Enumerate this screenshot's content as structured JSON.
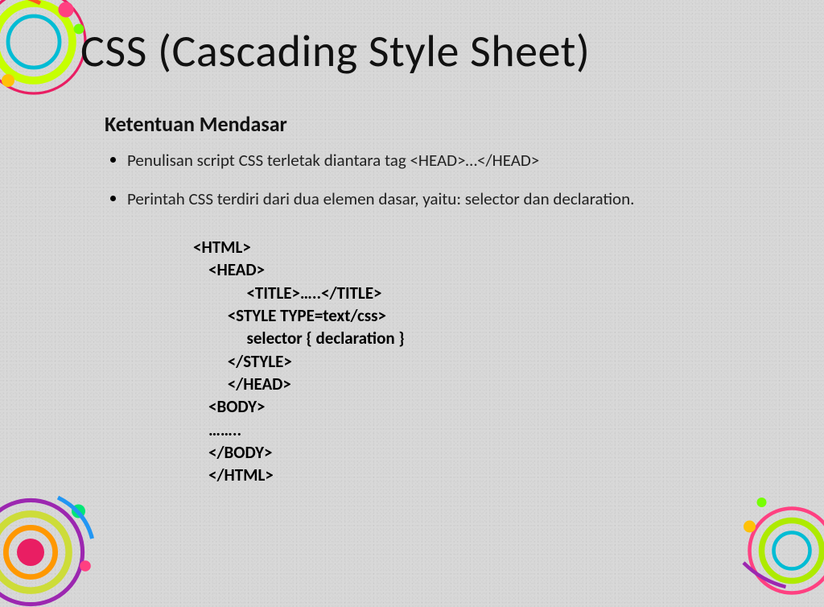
{
  "title": "CSS (Cascading Style Sheet)",
  "subtitle": "Ketentuan Mendasar",
  "bullets": [
    "Penulisan script CSS terletak diantara tag <HEAD>…</HEAD>",
    "Perintah CSS terdiri dari dua elemen dasar, yaitu: selector dan declaration."
  ],
  "code": "<HTML>\n    <HEAD>\n              <TITLE>…..</TITLE>\n         <STYLE TYPE=text/css>\n              selector { declaration }\n         </STYLE>\n         </HEAD>\n    <BODY>\n    ……..\n    </BODY>\n    </HTML>"
}
